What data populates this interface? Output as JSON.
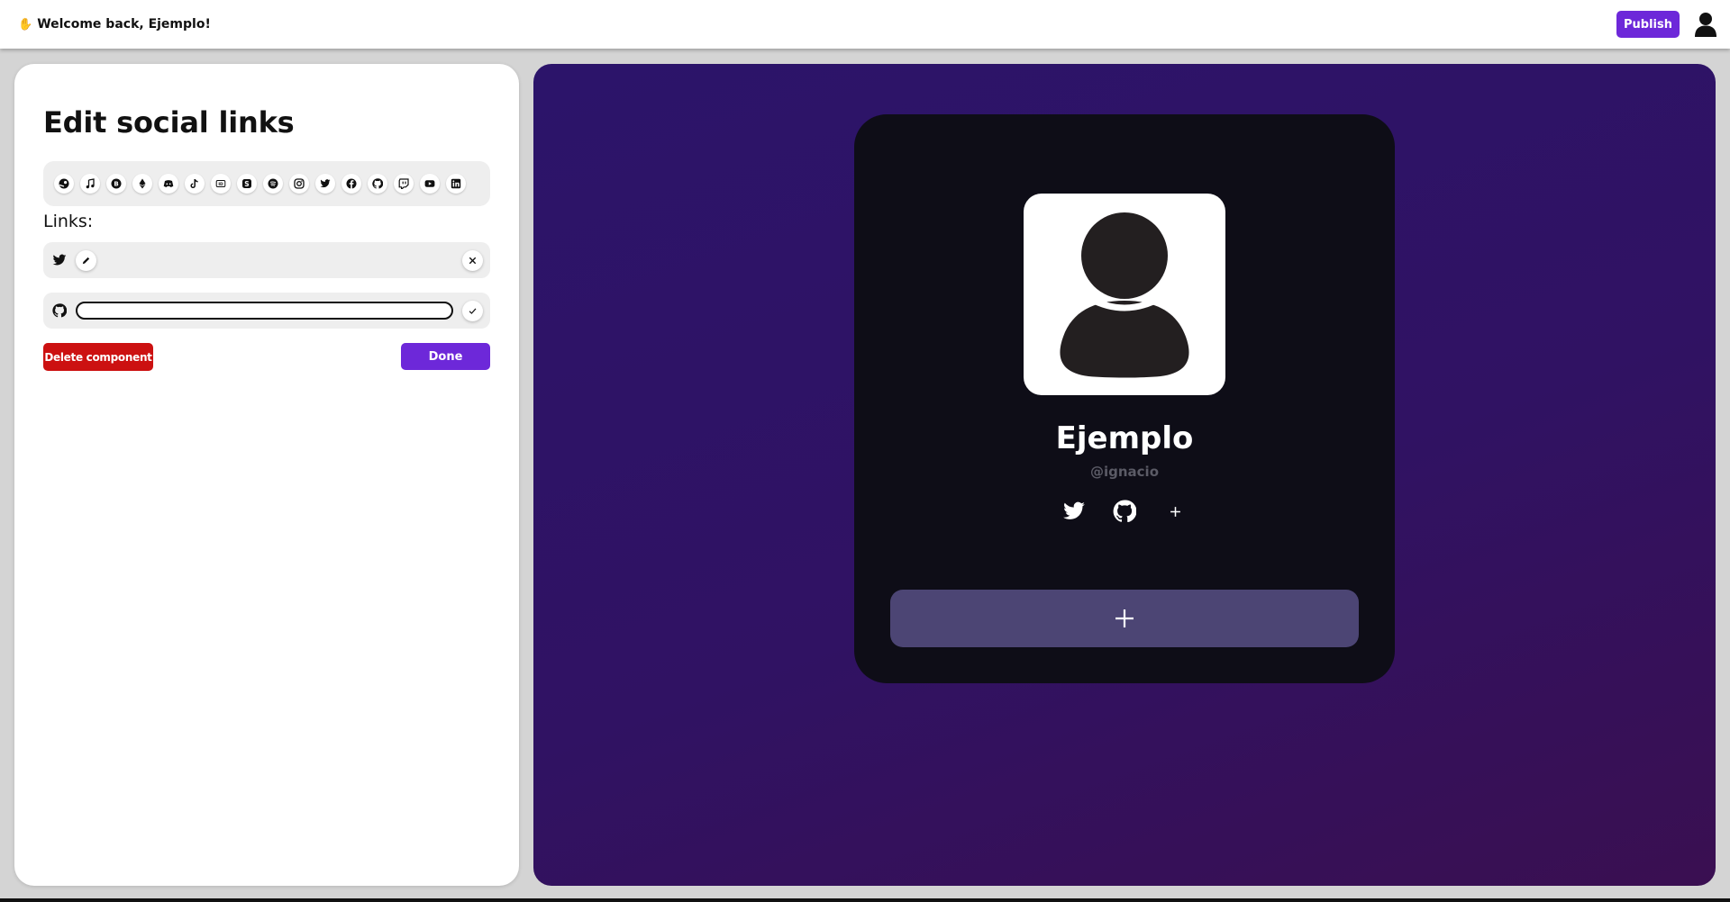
{
  "header": {
    "wave_icon": "waving-hand-icon",
    "welcome": "Welcome back, Ejemplo!",
    "publish_label": "Publish",
    "profile_icon": "user-avatar-icon"
  },
  "editor": {
    "title": "Edit social links",
    "available_icons": [
      "steam",
      "music",
      "bitcoin",
      "ethereum",
      "discord",
      "tiktok",
      "signal",
      "skype",
      "spotify",
      "instagram",
      "twitter",
      "facebook",
      "github",
      "twitch",
      "youtube",
      "linkedin"
    ],
    "links_label": "Links:",
    "links": [
      {
        "platform": "twitter",
        "mode": "saved"
      },
      {
        "platform": "github",
        "mode": "editing",
        "value": ""
      }
    ],
    "delete_label": "Delete component",
    "done_label": "Done"
  },
  "preview": {
    "name": "Ejemplo",
    "handle": "@ignacio",
    "socials": [
      "twitter",
      "github"
    ],
    "colors": {
      "background_start": "#2c146a",
      "background_end": "#3a0f51",
      "card": "#0e0d17",
      "add_block": "#4c4574"
    }
  },
  "colors": {
    "accent": "#6d28d9",
    "danger": "#cc1111"
  }
}
